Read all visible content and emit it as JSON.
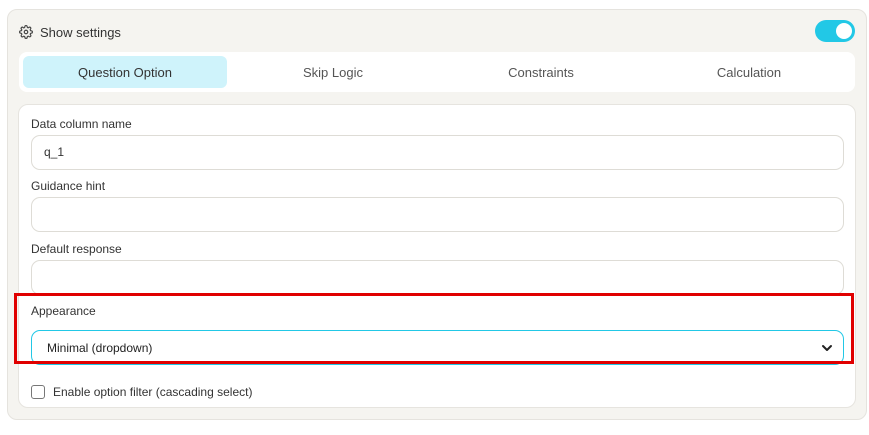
{
  "settings": {
    "title": "Show settings",
    "icon": "gear-icon",
    "toggle_on": true,
    "accent_color": "#22c8e6"
  },
  "tabs": [
    {
      "label": "Question Option",
      "active": true
    },
    {
      "label": "Skip Logic",
      "active": false
    },
    {
      "label": "Constraints",
      "active": false
    },
    {
      "label": "Calculation",
      "active": false
    }
  ],
  "form": {
    "data_column": {
      "label": "Data column name",
      "value": "q_1"
    },
    "guidance_hint": {
      "label": "Guidance hint",
      "value": ""
    },
    "default_response": {
      "label": "Default response",
      "value": ""
    },
    "appearance": {
      "label": "Appearance",
      "selected": "Minimal (dropdown)"
    },
    "option_filter": {
      "label": "Enable option filter (cascading select)",
      "checked": false
    }
  },
  "highlight_color": "#e00000"
}
